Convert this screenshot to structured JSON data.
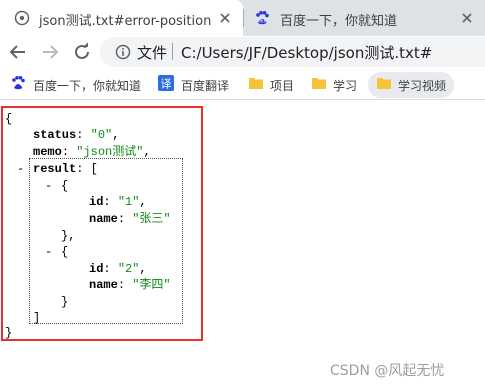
{
  "tabs": [
    {
      "title": "json测试.txt#error-position",
      "active": true
    },
    {
      "title": "百度一下，你就知道",
      "active": false
    }
  ],
  "toolbar": {
    "omnibox_label": "文件",
    "url": "C:/Users/JF/Desktop/json测试.txt#"
  },
  "bookmarks": [
    {
      "label": "百度一下，你就知道",
      "icon": "baidu-paw-icon"
    },
    {
      "label": "百度翻译",
      "icon": "translate-icon"
    },
    {
      "label": "项目",
      "icon": "folder-icon"
    },
    {
      "label": "学习",
      "icon": "folder-icon"
    },
    {
      "label": "学习视频",
      "icon": "folder-icon"
    }
  ],
  "json_view": {
    "open_brace": "{",
    "close_brace": "}",
    "status_key": "status",
    "status_value": "\"0\"",
    "memo_key": "memo",
    "memo_value": "\"json测试\"",
    "collapse_toggle": "-",
    "result_key": "result",
    "open_bracket": "[",
    "close_bracket": "]",
    "items": [
      {
        "id_key": "id",
        "id_value": "\"1\"",
        "name_key": "name",
        "name_value": "\"张三\""
      },
      {
        "id_key": "id",
        "id_value": "\"2\"",
        "name_key": "name",
        "name_value": "\"李四\""
      }
    ]
  },
  "watermark": "CSDN @风起无忧",
  "colors": {
    "frame": "#e8312f",
    "string": "#108a17",
    "tabstrip": "#dee1e6"
  }
}
